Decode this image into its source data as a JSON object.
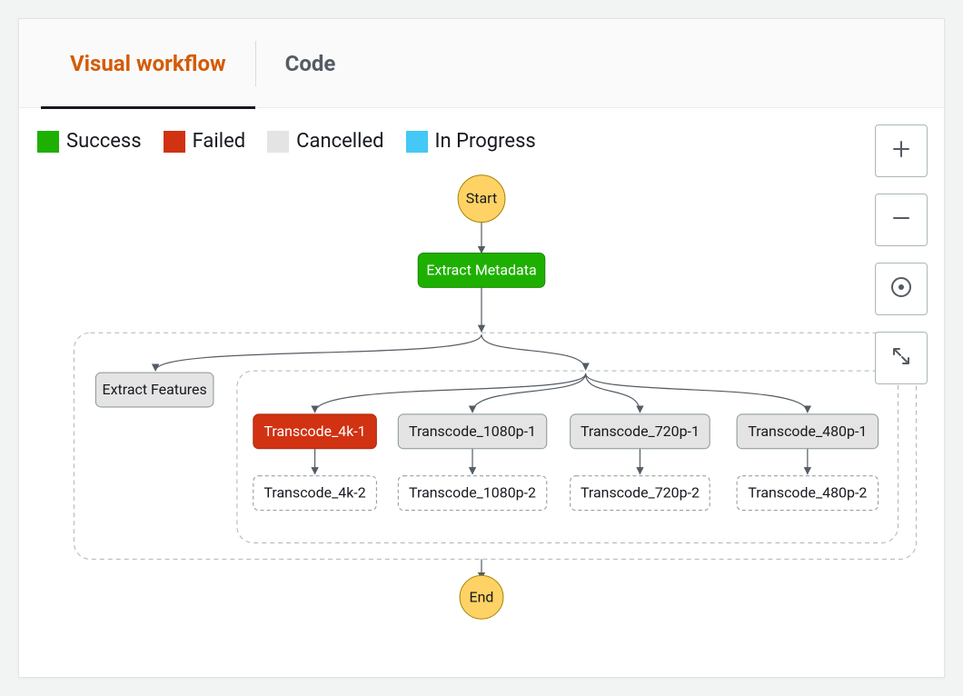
{
  "tabs": {
    "visual": "Visual workflow",
    "code": "Code"
  },
  "legend": {
    "success": "Success",
    "failed": "Failed",
    "cancelled": "Cancelled",
    "in_progress": "In Progress"
  },
  "colors": {
    "success": "#1eb000",
    "failed": "#d13212",
    "cancelled": "#e4e4e4",
    "in_progress": "#44c8f5"
  },
  "nodes": {
    "start": "Start",
    "extract_metadata": "Extract Metadata",
    "extract_features": "Extract Features",
    "transcode_4k_1": "Transcode_4k-1",
    "transcode_1080p_1": "Transcode_1080p-1",
    "transcode_720p_1": "Transcode_720p-1",
    "transcode_480p_1": "Transcode_480p-1",
    "transcode_4k_2": "Transcode_4k-2",
    "transcode_1080p_2": "Transcode_1080p-2",
    "transcode_720p_2": "Transcode_720p-2",
    "transcode_480p_2": "Transcode_480p-2",
    "end": "End"
  },
  "node_status": {
    "extract_metadata": "success",
    "extract_features": "cancelled",
    "transcode_4k_1": "failed",
    "transcode_1080p_1": "cancelled",
    "transcode_720p_1": "cancelled",
    "transcode_480p_1": "cancelled"
  }
}
